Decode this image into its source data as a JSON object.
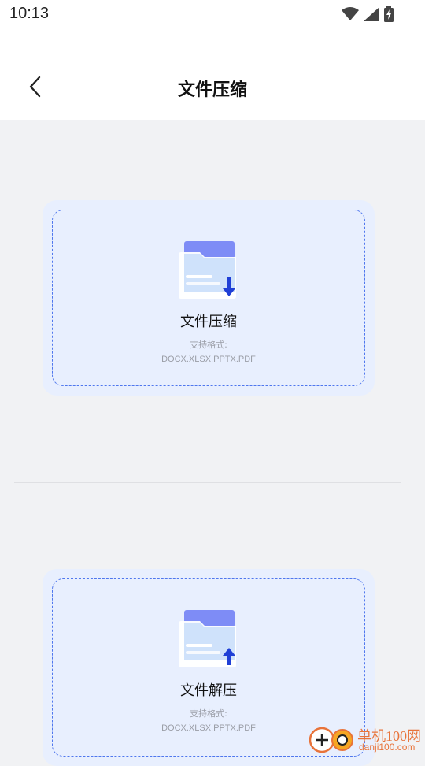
{
  "status_bar": {
    "time": "10:13",
    "icons": [
      "wifi-icon",
      "cellular-signal-icon",
      "battery-charging-icon"
    ]
  },
  "header": {
    "back_icon": "chevron-left-icon",
    "title": "文件压缩"
  },
  "cards": [
    {
      "title": "文件压缩",
      "support_label": "支持格式:",
      "formats": "DOCX.XLSX.PPTX.PDF",
      "icon": "folder-download-icon"
    },
    {
      "title": "文件解压",
      "support_label": "支持格式:",
      "formats": "DOCX.XLSX.PPTX.PDF",
      "icon": "folder-upload-icon"
    }
  ],
  "watermark": {
    "brand": "单机100网",
    "url": "danji100.com"
  },
  "colors": {
    "accent": "#2140d8",
    "card_background": "#e8effe",
    "dash_border": "#4f77ee",
    "page_background": "#f1f2f4",
    "watermark": "#e8733a"
  }
}
